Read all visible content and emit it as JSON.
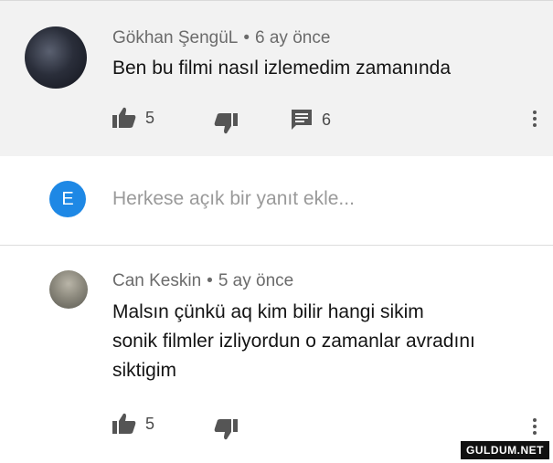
{
  "comments": [
    {
      "author": "Gökhan ŞengüL",
      "time": "6 ay önce",
      "text": "Ben bu filmi nasıl izlemedim zamanında",
      "likes": "5",
      "replies": "6"
    },
    {
      "author": "Can Keskin",
      "time": "5 ay önce",
      "text_lines": [
        "Malsın çünkü aq kim bilir hangi sikim",
        "sonik filmler izliyordun o zamanlar avradını",
        "siktigim"
      ],
      "likes": "5"
    }
  ],
  "reply_box": {
    "avatar_letter": "E",
    "placeholder": "Herkese açık bir yanıt ekle..."
  },
  "separator": "•",
  "watermark": "GULDUM.NET"
}
